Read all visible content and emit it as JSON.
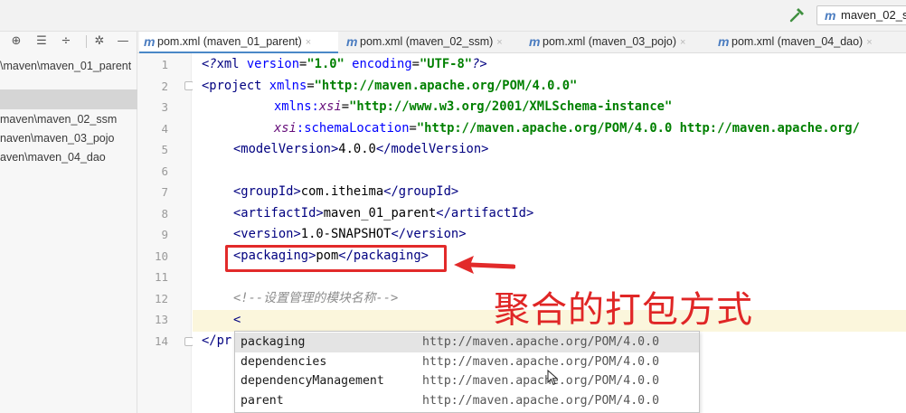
{
  "toolbar": {
    "run_config": "maven_02_s",
    "hammer_icon": "hammer-icon"
  },
  "project": {
    "rows": [
      "\\maven\\maven_01_parent",
      "",
      "maven\\maven_02_ssm",
      "naven\\maven_03_pojo",
      "aven\\maven_04_dao"
    ]
  },
  "tabs": [
    {
      "label": "pom.xml (maven_01_parent)",
      "active": true
    },
    {
      "label": "pom.xml (maven_02_ssm)",
      "active": false
    },
    {
      "label": "pom.xml (maven_03_pojo)",
      "active": false
    },
    {
      "label": "pom.xml (maven_04_dao)",
      "active": false
    }
  ],
  "tab_close": "×",
  "line_numbers": [
    "1",
    "2",
    "3",
    "4",
    "5",
    "6",
    "7",
    "8",
    "9",
    "10",
    "11",
    "12",
    "13",
    "14"
  ],
  "code": {
    "l1_a": "<?",
    "l1_b": "xml ",
    "l1_c": "version",
    "l1_d": "=",
    "l1_e": "\"1.0\"",
    "l1_f": " encoding",
    "l1_g": "=",
    "l1_h": "\"UTF-8\"",
    "l1_i": "?>",
    "l2_a": "<project ",
    "l2_b": "xmlns",
    "l2_c": "=",
    "l2_d": "\"http://maven.apache.org/POM/4.0.0\"",
    "l3_a": "xmlns:",
    "l3_b": "xsi",
    "l3_c": "=",
    "l3_d": "\"http://www.w3.org/2001/XMLSchema-instance\"",
    "l4_a": "xsi",
    "l4_b": ":schemaLocation",
    "l4_c": "=",
    "l4_d": "\"http://maven.apache.org/POM/4.0.0 http://maven.apache.org/",
    "l5_a": "<modelVersion>",
    "l5_b": "4.0.0",
    "l5_c": "</modelVersion>",
    "l7_a": "<groupId>",
    "l7_b": "com.itheima",
    "l7_c": "</groupId>",
    "l8_a": "<artifactId>",
    "l8_b": "maven_01_parent",
    "l8_c": "</artifactId>",
    "l9_a": "<version>",
    "l9_b": "1.0-SNAPSHOT",
    "l9_c": "</version>",
    "l10_a": "<packaging>",
    "l10_b": "pom",
    "l10_c": "</packaging>",
    "l12": "<!--设置管理的模块名称-->",
    "l13": "<",
    "l14": "</pr"
  },
  "annotation": {
    "text": "聚合的打包方式",
    "color": "#e02626"
  },
  "completion": [
    {
      "name": "packaging",
      "uri": "http://maven.apache.org/POM/4.0.0",
      "selected": true
    },
    {
      "name": "dependencies",
      "uri": "http://maven.apache.org/POM/4.0.0",
      "selected": false
    },
    {
      "name": "dependencyManagement",
      "uri": "http://maven.apache.org/POM/4.0.0",
      "selected": false
    },
    {
      "name": "parent",
      "uri": "http://maven.apache.org/POM/4.0.0",
      "selected": false
    }
  ]
}
